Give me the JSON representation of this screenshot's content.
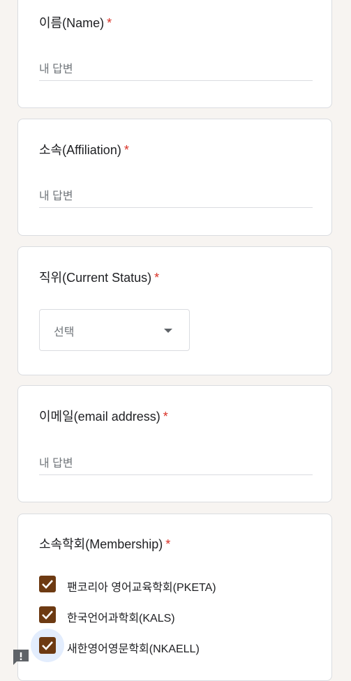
{
  "questions": {
    "name": {
      "title": "이름(Name)",
      "required_mark": "*",
      "placeholder": "내 답변"
    },
    "affiliation": {
      "title": "소속(Affiliation)",
      "required_mark": "*",
      "placeholder": "내 답변"
    },
    "status": {
      "title": "직위(Current Status)",
      "required_mark": "*",
      "selected": "선택"
    },
    "email": {
      "title": "이메일(email address)",
      "required_mark": "*",
      "placeholder": "내 답변"
    },
    "membership": {
      "title": "소속학회(Membership)",
      "required_mark": "*",
      "options": [
        {
          "label": "팬코리아 영어교육학회(PKETA)",
          "checked": true
        },
        {
          "label": "한국언어과학회(KALS)",
          "checked": true
        },
        {
          "label": "새한영어영문학회(NKAELL)",
          "checked": true
        }
      ]
    }
  },
  "colors": {
    "page_background": "#f7f4f1",
    "checkbox": "#6d3a12",
    "required": "#d93025"
  },
  "icons": {
    "dropdown": "caret-down-icon",
    "checkbox": "checkmark-icon",
    "feedback": "report-problem-icon"
  }
}
